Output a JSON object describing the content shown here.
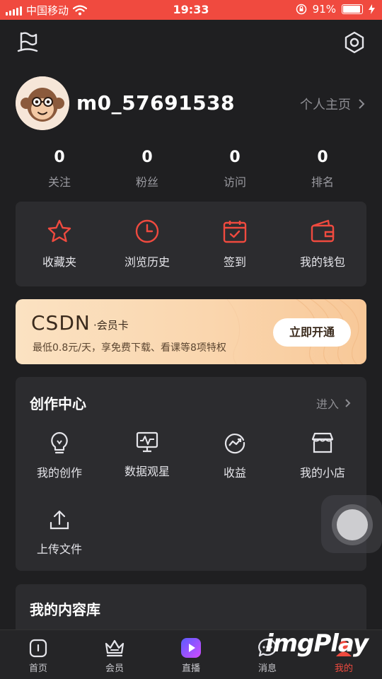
{
  "status_bar": {
    "carrier": "中国移动",
    "time": "19:33",
    "battery_percent": "91%",
    "battery_level": 0.91
  },
  "profile": {
    "username": "m0_57691538",
    "homepage_label": "个人主页",
    "stats": [
      {
        "value": "0",
        "label": "关注"
      },
      {
        "value": "0",
        "label": "粉丝"
      },
      {
        "value": "0",
        "label": "访问"
      },
      {
        "value": "0",
        "label": "排名"
      }
    ]
  },
  "quick_actions": [
    {
      "label": "收藏夹",
      "icon": "star-icon"
    },
    {
      "label": "浏览历史",
      "icon": "clock-icon"
    },
    {
      "label": "签到",
      "icon": "calendar-check-icon"
    },
    {
      "label": "我的钱包",
      "icon": "wallet-icon"
    }
  ],
  "vip_banner": {
    "logo": "CSDN",
    "tag": "·会员卡",
    "description": "最低0.8元/天，享免费下载、看课等8项特权",
    "button_label": "立即开通"
  },
  "creation_center": {
    "title": "创作中心",
    "enter_label": "进入",
    "items": [
      {
        "label": "我的创作",
        "icon": "lightbulb-icon"
      },
      {
        "label": "数据观星",
        "icon": "monitor-chart-icon"
      },
      {
        "label": "收益",
        "icon": "earnings-icon"
      },
      {
        "label": "我的小店",
        "icon": "store-icon"
      },
      {
        "label": "上传文件",
        "icon": "upload-icon"
      }
    ]
  },
  "content_library": {
    "title": "我的内容库"
  },
  "tab_bar": [
    {
      "label": "首页",
      "icon": "home-icon"
    },
    {
      "label": "会员",
      "icon": "crown-icon"
    },
    {
      "label": "直播",
      "icon": "live-play-icon"
    },
    {
      "label": "消息",
      "icon": "message-icon"
    },
    {
      "label": "我的",
      "icon": "profile-icon"
    }
  ],
  "watermark": "imgPlay",
  "colors": {
    "accent": "#f04a3f",
    "background": "#1f1f21",
    "card": "#2c2c2f"
  }
}
